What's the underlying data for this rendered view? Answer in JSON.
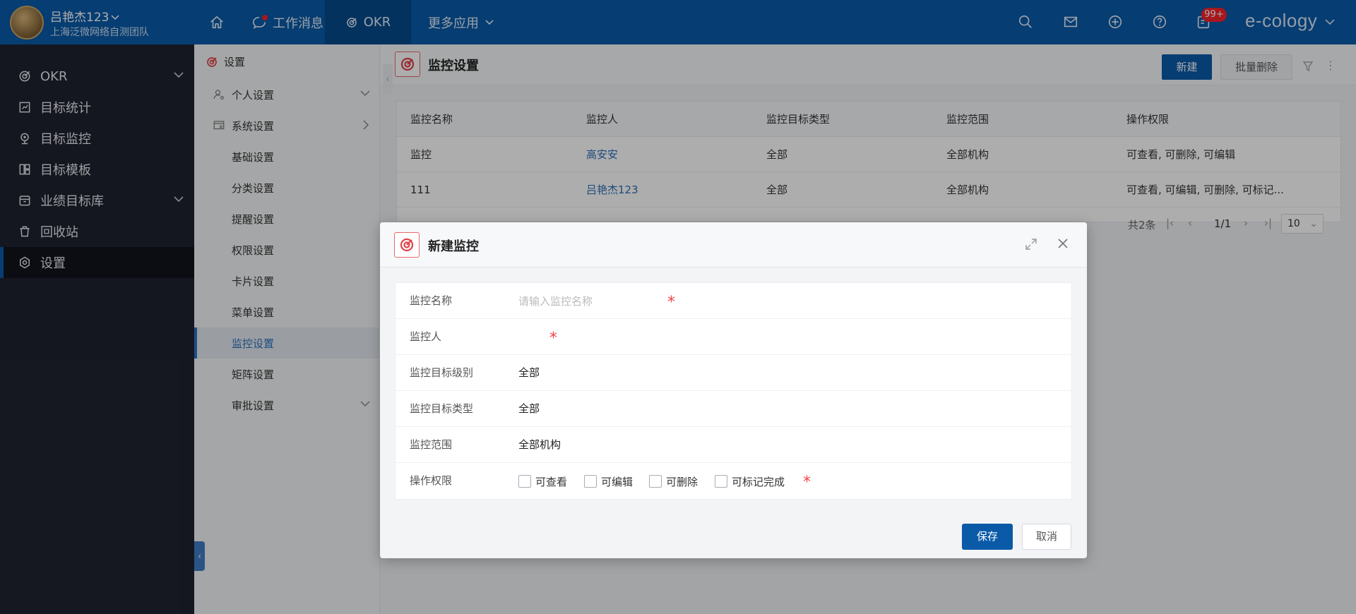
{
  "topbar": {
    "user_name": "吕艳杰123",
    "user_team": "上海泛微网络自测团队",
    "nav_messages": "工作消息",
    "nav_okr": "OKR",
    "nav_more": "更多应用",
    "message_badge": "99+",
    "brand": "e-cology"
  },
  "sidebar": {
    "items": [
      {
        "label": "OKR",
        "icon": "okr-icon"
      },
      {
        "label": "目标统计",
        "icon": "stats-icon"
      },
      {
        "label": "目标监控",
        "icon": "monitor-icon"
      },
      {
        "label": "目标模板",
        "icon": "template-icon"
      },
      {
        "label": "业绩目标库",
        "icon": "library-icon"
      },
      {
        "label": "回收站",
        "icon": "trash-icon"
      },
      {
        "label": "设置",
        "icon": "settings-icon"
      }
    ]
  },
  "submenu": {
    "title": "设置",
    "items": [
      {
        "label": "个人设置"
      },
      {
        "label": "系统设置"
      },
      {
        "label": "基础设置"
      },
      {
        "label": "分类设置"
      },
      {
        "label": "提醒设置"
      },
      {
        "label": "权限设置"
      },
      {
        "label": "卡片设置"
      },
      {
        "label": "菜单设置"
      },
      {
        "label": "监控设置"
      },
      {
        "label": "矩阵设置"
      },
      {
        "label": "审批设置"
      }
    ]
  },
  "main": {
    "title": "监控设置",
    "new_button": "新建",
    "batch_delete_button": "批量删除",
    "table": {
      "headers": [
        "监控名称",
        "监控人",
        "监控目标类型",
        "监控范围",
        "操作权限"
      ],
      "rows": [
        [
          "监控",
          "高安安",
          "全部",
          "全部机构",
          "可查看, 可删除, 可编辑"
        ],
        [
          "111",
          "吕艳杰123",
          "全部",
          "全部机构",
          "可查看, 可编辑, 可删除, 可标记..."
        ]
      ]
    },
    "pager": {
      "total": "共2条",
      "page": "1/1",
      "page_size": "10"
    }
  },
  "modal": {
    "title": "新建监控",
    "fields": {
      "name_label": "监控名称",
      "name_placeholder": "请输入监控名称",
      "name_value": "",
      "monitor_person_label": "监控人",
      "level_label": "监控目标级别",
      "level_value": "全部",
      "type_label": "监控目标类型",
      "type_value": "全部",
      "scope_label": "监控范围",
      "scope_value": "全部机构",
      "perm_label": "操作权限",
      "perm_options": [
        "可查看",
        "可编辑",
        "可删除",
        "可标记完成"
      ],
      "required_mark": "*"
    },
    "save_button": "保存",
    "cancel_button": "取消"
  },
  "colors": {
    "topbar": "#0a5aa8",
    "sidebar": "#1f2330",
    "primary_button": "#0a5aa8",
    "link": "#2b6fb8",
    "required": "#f0434a"
  }
}
